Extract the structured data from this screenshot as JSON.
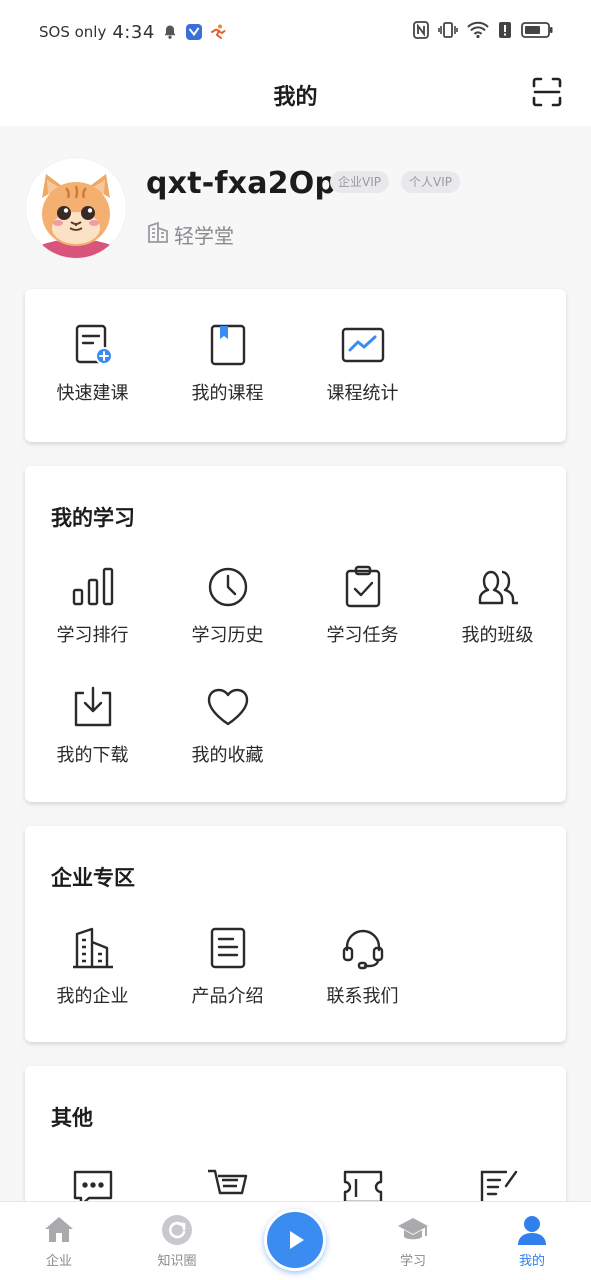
{
  "status_bar": {
    "carrier": "SOS only",
    "time": "4:34",
    "icons": [
      "bell-icon",
      "app-badge-icon",
      "runner-icon",
      "nfc-icon",
      "vibrate-icon",
      "wifi-icon",
      "alert-icon",
      "battery-icon"
    ]
  },
  "header": {
    "title": "我的",
    "scan_icon": "scan-icon"
  },
  "profile": {
    "username": "qxt-fxa2Op",
    "badges": [
      "企业VIP",
      "个人VIP"
    ],
    "company": "轻学堂"
  },
  "quick": {
    "items": [
      {
        "label": "快速建课",
        "icon": "quick-create-course-icon"
      },
      {
        "label": "我的课程",
        "icon": "book-icon"
      },
      {
        "label": "课程统计",
        "icon": "chart-icon"
      }
    ]
  },
  "learning": {
    "title": "我的学习",
    "items": [
      {
        "label": "学习排行",
        "icon": "ranking-icon"
      },
      {
        "label": "学习历史",
        "icon": "clock-icon"
      },
      {
        "label": "学习任务",
        "icon": "clipboard-check-icon"
      },
      {
        "label": "我的班级",
        "icon": "users-icon"
      },
      {
        "label": "我的下载",
        "icon": "download-icon"
      },
      {
        "label": "我的收藏",
        "icon": "heart-icon"
      }
    ]
  },
  "enterprise": {
    "title": "企业专区",
    "items": [
      {
        "label": "我的企业",
        "icon": "building-icon"
      },
      {
        "label": "产品介绍",
        "icon": "document-icon"
      },
      {
        "label": "联系我们",
        "icon": "headset-icon"
      }
    ]
  },
  "other": {
    "title": "其他",
    "items": [
      {
        "icon": "chat-icon"
      },
      {
        "icon": "cart-icon"
      },
      {
        "icon": "ticket-icon"
      },
      {
        "icon": "edit-list-icon"
      }
    ]
  },
  "tabbar": {
    "tabs": [
      {
        "label": "企业",
        "icon": "home-icon",
        "active": false
      },
      {
        "label": "知识圈",
        "icon": "refresh-circle-icon",
        "active": false
      },
      {
        "label": "学习",
        "icon": "graduation-cap-icon",
        "active": false
      },
      {
        "label": "我的",
        "icon": "user-icon",
        "active": true
      }
    ],
    "play_icon": "play-icon"
  },
  "colors": {
    "accent": "#2f80ed",
    "play": "#3b8cf0",
    "background": "#f7f7f8",
    "badge": "#e9e9eb"
  }
}
